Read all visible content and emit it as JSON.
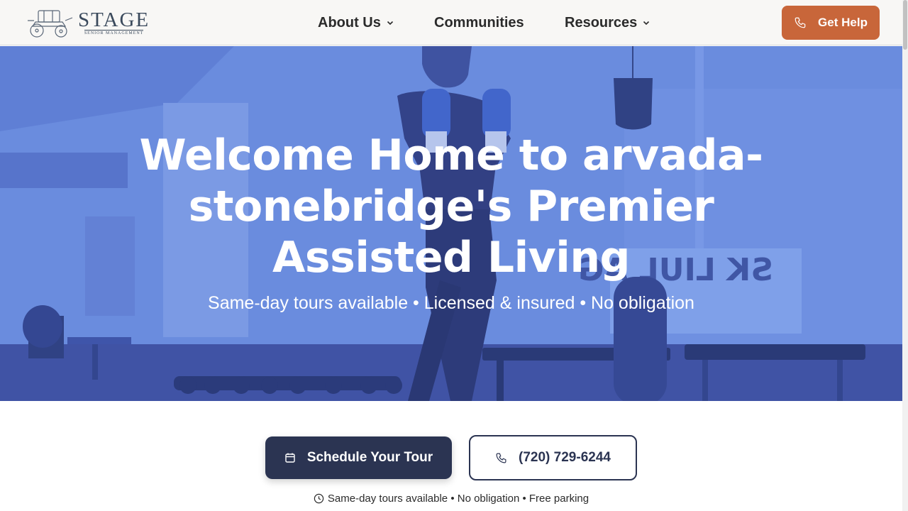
{
  "brand": {
    "name": "STAGE",
    "tagline": "Senior Management"
  },
  "nav": {
    "about": "About Us",
    "communities": "Communities",
    "resources": "Resources"
  },
  "header": {
    "help_label": "Get Help"
  },
  "hero": {
    "title": "Welcome Home to arvada-stonebridge's Premier Assisted Living",
    "subtitle": "Same-day tours available • Licensed & insured • No obligation"
  },
  "cta": {
    "tour_label": "Schedule Your Tour",
    "phone_label": "(720) 729-6244",
    "note": "Same-day tours available • No obligation • Free parking"
  },
  "colors": {
    "accent": "#c8663a",
    "primary": "#2b3452",
    "hero_tint": "#6f91e0"
  },
  "icons": [
    "stagecoach-logo",
    "chevron-down-icon",
    "phone-icon",
    "calendar-icon",
    "clock-icon"
  ]
}
